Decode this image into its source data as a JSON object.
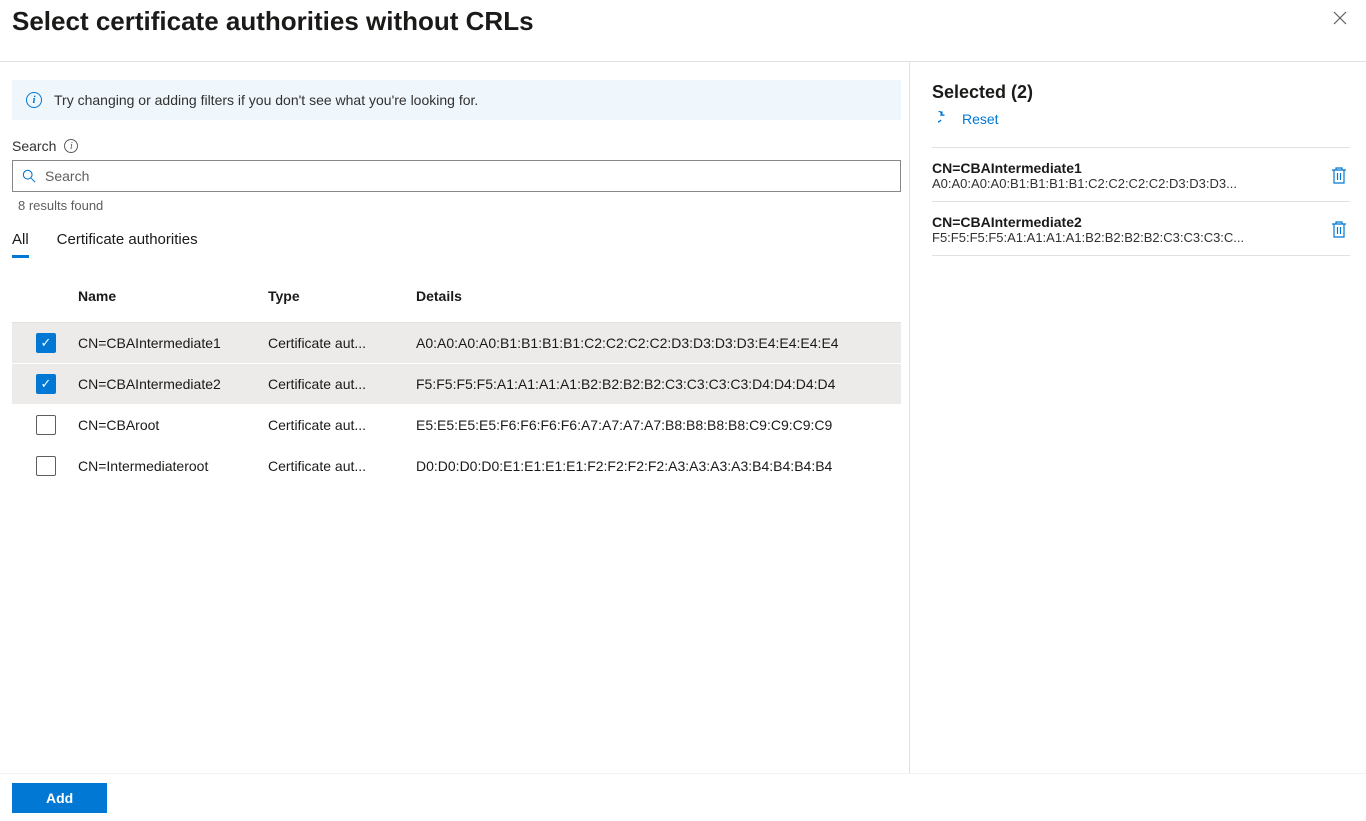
{
  "header": {
    "title": "Select certificate authorities without CRLs"
  },
  "info": {
    "message": "Try changing or adding filters if you don't see what you're looking for."
  },
  "search": {
    "label": "Search",
    "placeholder": "Search",
    "results_text": "8 results found"
  },
  "tabs": {
    "all": "All",
    "ca": "Certificate authorities"
  },
  "table": {
    "columns": {
      "name": "Name",
      "type": "Type",
      "details": "Details"
    },
    "rows": [
      {
        "checked": true,
        "name": "CN=CBAIntermediate1",
        "type": "Certificate aut...",
        "details": "A0:A0:A0:A0:B1:B1:B1:B1:C2:C2:C2:C2:D3:D3:D3:D3:E4:E4:E4:E4"
      },
      {
        "checked": true,
        "name": "CN=CBAIntermediate2",
        "type": "Certificate aut...",
        "details": "F5:F5:F5:F5:A1:A1:A1:A1:B2:B2:B2:B2:C3:C3:C3:C3:D4:D4:D4:D4"
      },
      {
        "checked": false,
        "name": "CN=CBAroot",
        "type": "Certificate aut...",
        "details": "E5:E5:E5:E5:F6:F6:F6:F6:A7:A7:A7:A7:B8:B8:B8:B8:C9:C9:C9:C9"
      },
      {
        "checked": false,
        "name": "CN=Intermediateroot",
        "type": "Certificate aut...",
        "details": "D0:D0:D0:D0:E1:E1:E1:E1:F2:F2:F2:F2:A3:A3:A3:A3:B4:B4:B4:B4"
      }
    ]
  },
  "selected": {
    "heading": "Selected (2)",
    "reset_label": "Reset",
    "items": [
      {
        "name": "CN=CBAIntermediate1",
        "details": "A0:A0:A0:A0:B1:B1:B1:B1:C2:C2:C2:C2:D3:D3:D3..."
      },
      {
        "name": "CN=CBAIntermediate2",
        "details": "F5:F5:F5:F5:A1:A1:A1:A1:B2:B2:B2:B2:C3:C3:C3:C..."
      }
    ]
  },
  "footer": {
    "add_label": "Add"
  }
}
